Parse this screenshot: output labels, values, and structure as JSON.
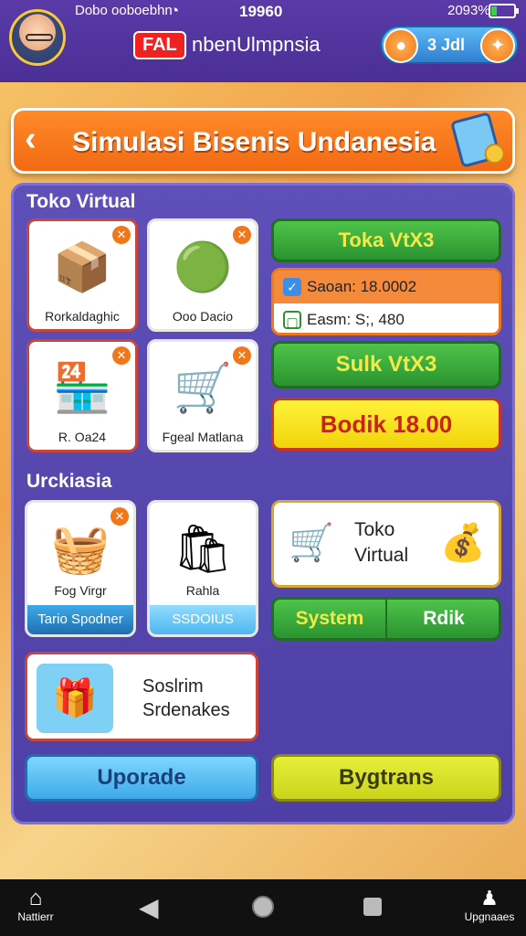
{
  "status_bar": {
    "carrier": "Dobo ooboebhn",
    "time": "19960",
    "battery": "2093%",
    "wifi_icon": "wifi-icon"
  },
  "header": {
    "badge": "FAL",
    "title": "nbenUlmpnsia",
    "coins_value": "3 Jdl"
  },
  "banner": {
    "title": "Simulasi Bisenis Undanesia",
    "back_icon": "chevron-left-icon"
  },
  "section1": {
    "label": "Toko Virtual",
    "tiles": [
      {
        "caption": "Rorkaldaghic",
        "icon": "crate-icon"
      },
      {
        "caption": "Ooo Dacio",
        "icon": "vacuum-icon"
      },
      {
        "caption": "R. Oa24",
        "icon": "market-stall-icon"
      },
      {
        "caption": "Fgeal Matlana",
        "icon": "shopping-cart-icon"
      }
    ],
    "top_button": "Toka VtX3",
    "info": {
      "row1": "Saoan: 18.0002",
      "row2": "Easm: S;, 480"
    },
    "mid_button": "Sulk VtX3",
    "bottom_button": "Bodik 18.00"
  },
  "section2": {
    "label": "Urckiasia",
    "tiles": [
      {
        "caption": "Fog Virgr",
        "footer": "Tario Spodner",
        "icon": "basket-icon"
      },
      {
        "caption": "Rahla",
        "footer": "SSDOIUS",
        "icon": "cart-stall-icon"
      }
    ],
    "store_card": {
      "line1": "Toko",
      "line2": "Virtual"
    },
    "split_button": {
      "left": "System",
      "right": "Rdik"
    },
    "wide_card": {
      "line1": "Soslrim",
      "line2": "Srdenakes"
    },
    "upgrade_button": "Uporade",
    "right_button": "Bygtrans"
  },
  "nav": {
    "home_label": "Nattierr",
    "upgrade_label": "Upgnaaes"
  },
  "colors": {
    "accent_orange": "#f26a12",
    "panel_purple": "#5746b2",
    "green": "#2a9430",
    "yellow": "#f1d40a"
  }
}
